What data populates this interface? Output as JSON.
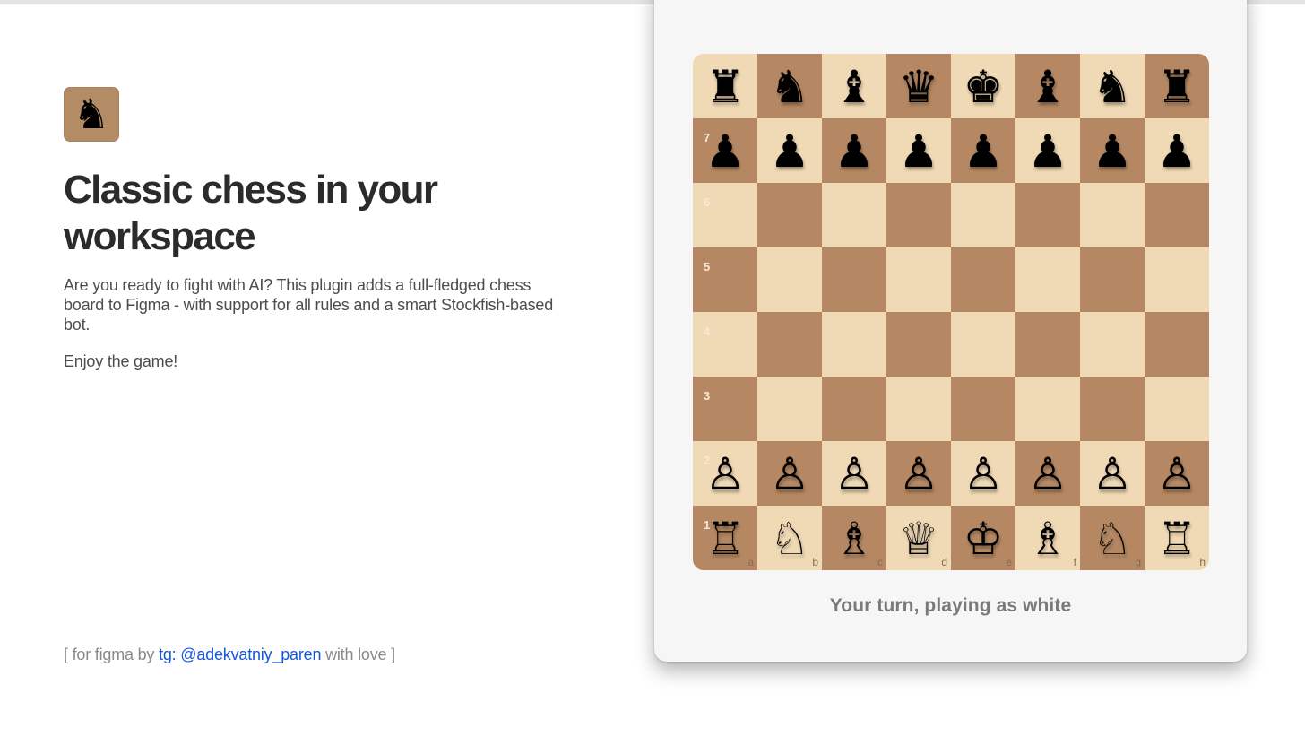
{
  "intro": {
    "logo_icon": "chess-knight-icon",
    "logo_glyph": "♞",
    "logo_color": "#b38b65",
    "title": "Classic chess in your workspace",
    "description": "Are you ready to fight with AI? This plugin adds a full-fledged chess board to Figma - with support for all rules and a smart Stockfish-based bot.",
    "enjoy": "Enjoy the game!"
  },
  "footer": {
    "prefix": "[ for figma by",
    "link_text": "tg: @adekvatniy_paren",
    "suffix": "with love ]",
    "link_color": "#1558d6"
  },
  "board": {
    "light_color": "#f0d9b5",
    "dark_color": "#b58863",
    "ranks": [
      {
        "label": "",
        "pieces": [
          "♜",
          "♞",
          "♝",
          "♛",
          "♚",
          "♝",
          "♞",
          "♜"
        ]
      },
      {
        "label": "7",
        "pieces": [
          "♟",
          "♟",
          "♟",
          "♟",
          "♟",
          "♟",
          "♟",
          "♟"
        ]
      },
      {
        "label": "6",
        "pieces": [
          "",
          "",
          "",
          "",
          "",
          "",
          "",
          ""
        ]
      },
      {
        "label": "5",
        "pieces": [
          "",
          "",
          "",
          "",
          "",
          "",
          "",
          ""
        ]
      },
      {
        "label": "4",
        "pieces": [
          "",
          "",
          "",
          "",
          "",
          "",
          "",
          ""
        ]
      },
      {
        "label": "3",
        "pieces": [
          "",
          "",
          "",
          "",
          "",
          "",
          "",
          ""
        ]
      },
      {
        "label": "2",
        "pieces": [
          "♙",
          "♙",
          "♙",
          "♙",
          "♙",
          "♙",
          "♙",
          "♙"
        ]
      },
      {
        "label": "1",
        "pieces": [
          "♖",
          "♘",
          "♗",
          "♕",
          "♔",
          "♗",
          "♘",
          "♖"
        ]
      }
    ],
    "files": [
      "a",
      "b",
      "c",
      "d",
      "e",
      "f",
      "g",
      "h"
    ]
  },
  "status": "Your turn, playing as white"
}
